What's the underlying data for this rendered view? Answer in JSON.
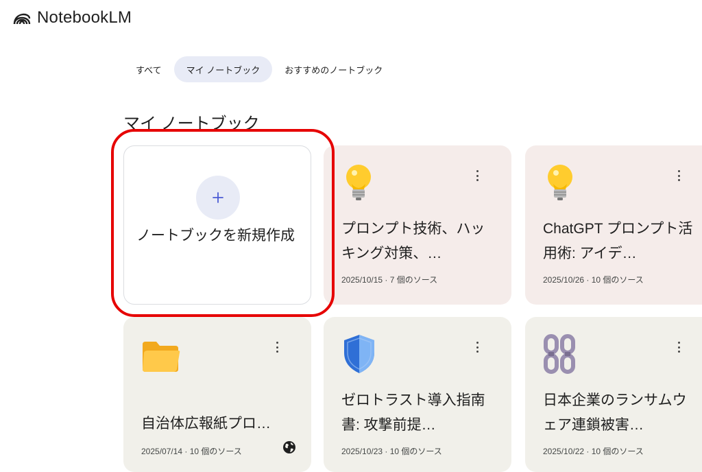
{
  "app": {
    "name": "NotebookLM",
    "icon": "notebooklm-logo-icon"
  },
  "tabs": [
    {
      "label": "すべて",
      "active": false
    },
    {
      "label": "マイ ノートブック",
      "active": true
    },
    {
      "label": "おすすめのノートブック",
      "active": false
    }
  ],
  "section": {
    "title": "マイ ノートブック"
  },
  "new_notebook": {
    "label": "ノートブックを新規作成",
    "icon": "plus-icon"
  },
  "notebooks": [
    {
      "icon": "lightbulb-icon",
      "title": "プロンプト技術、ハッキング対策、…",
      "meta": "2025/10/15 · 7 個のソース",
      "color": "#f5ecea"
    },
    {
      "icon": "lightbulb-icon",
      "title": "ChatGPT プロンプト活用術: アイデ…",
      "meta": "2025/10/26 · 10 個のソース",
      "color": "#f5ecea"
    },
    {
      "icon": "folder-icon",
      "title": "自治体広報紙プロ…",
      "meta": "2025/07/14 · 10 個のソース",
      "color": "#f1f0ea",
      "badge": "globe-icon"
    },
    {
      "icon": "shield-icon",
      "title": "ゼロトラスト導入指南書: 攻撃前提…",
      "meta": "2025/10/23 · 10 個のソース",
      "color": "#f1f0ea"
    },
    {
      "icon": "chain-icon",
      "title": "日本企業のランサムウェア連鎖被害…",
      "meta": "2025/10/22 · 10 個のソース",
      "color": "#f1f0ea"
    }
  ],
  "annotation": {
    "color": "#e60000"
  }
}
